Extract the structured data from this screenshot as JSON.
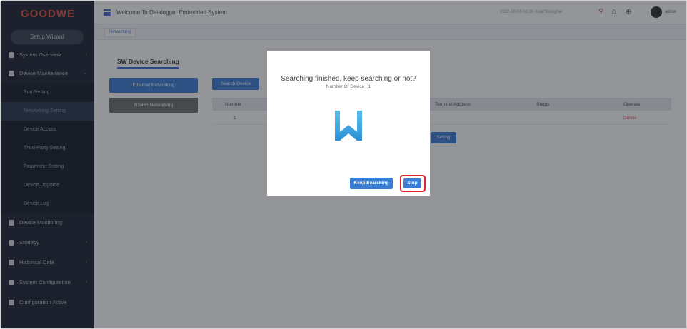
{
  "sidebar": {
    "logo": "GOODWE",
    "setup_wizard": "Setup Wizard",
    "items": [
      {
        "label": "System Overview"
      },
      {
        "label": "Device Maintenance"
      },
      {
        "label": "Device Monitoring"
      },
      {
        "label": "Strategy"
      },
      {
        "label": "Historical Data"
      },
      {
        "label": "System Configuration"
      },
      {
        "label": "Configuration Active"
      }
    ],
    "subitems": [
      {
        "label": "Port Setting"
      },
      {
        "label": "Networking Setting"
      },
      {
        "label": "Device Access"
      },
      {
        "label": "Third-Party Setting"
      },
      {
        "label": "Parameter Setting"
      },
      {
        "label": "Device Upgrade"
      },
      {
        "label": "Device Log"
      }
    ]
  },
  "header": {
    "title": "Welcome To Datalogger Embedded System",
    "datetime": "2022-10-08 08:30 Asia/Shanghai",
    "username": "admin"
  },
  "breadcrumb": {
    "tab": "Networking"
  },
  "main": {
    "section_title": "SW Device Searching",
    "ethernet_button": "Ethernet Networking",
    "rs485_button": "RS485 Networking",
    "search_button": "Search Device",
    "table": {
      "headers": [
        "Number",
        "Terminal Address",
        "Status",
        "Operate"
      ],
      "rows": [
        {
          "number": "1",
          "operate": "Delete"
        }
      ]
    },
    "setting_button": "Setting"
  },
  "modal": {
    "title": "Searching finished, keep searching or not?",
    "device_count": "Number Of Device : 1",
    "keep_button": "Keep Searching",
    "stop_button": "Stop"
  },
  "colors": {
    "accent": "#3a7dd4",
    "highlight": "#e0232f",
    "sidebar": "#1b2230",
    "logo_w": "#2e9ad8"
  }
}
